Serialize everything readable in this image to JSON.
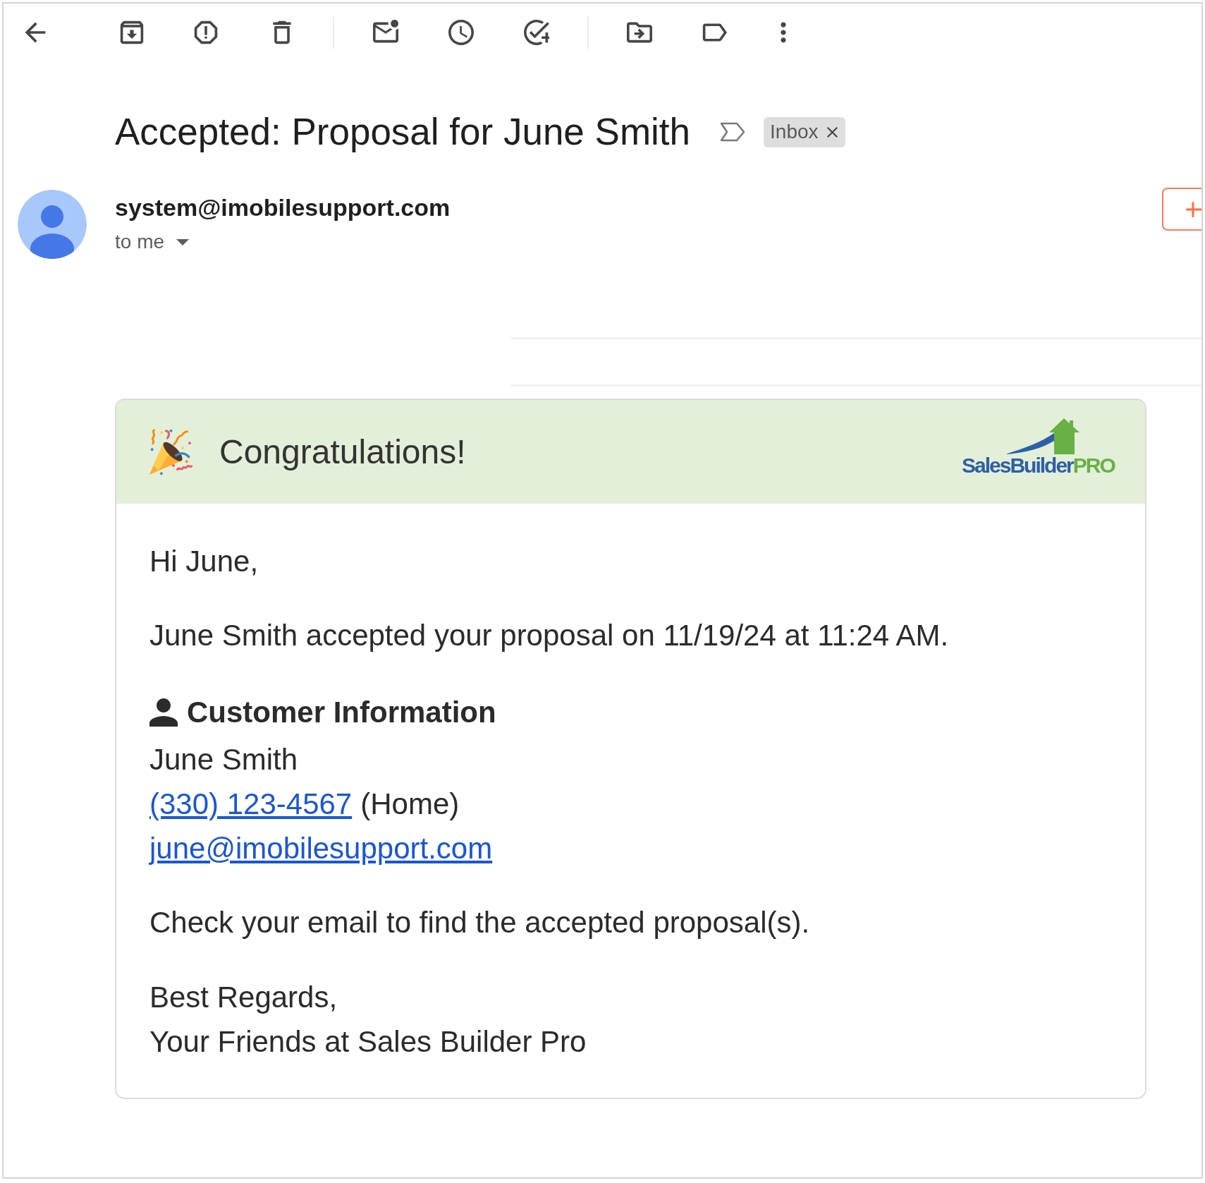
{
  "subject": {
    "title": "Accepted: Proposal for June Smith",
    "important": false,
    "labels": [
      "Inbox"
    ]
  },
  "sender": {
    "email": "system@imobilesupport.com",
    "recipient": "to me"
  },
  "message": {
    "banner": {
      "heading": "Congratulations!",
      "logo": {
        "name": "SalesBuilder",
        "suffix": "PRO"
      }
    },
    "greeting": "Hi June,",
    "summary": "June Smith accepted your proposal on 11/19/24 at 11:24 AM.",
    "customer": {
      "heading": "Customer Information",
      "name": "June Smith",
      "phone": "(330) 123-4567",
      "phone_type": "(Home)",
      "email": "june@imobilesupport.com"
    },
    "note": "Check your email to find the accepted proposal(s).",
    "signoff": [
      "Best Regards,",
      "Your Friends at Sales Builder Pro"
    ]
  }
}
